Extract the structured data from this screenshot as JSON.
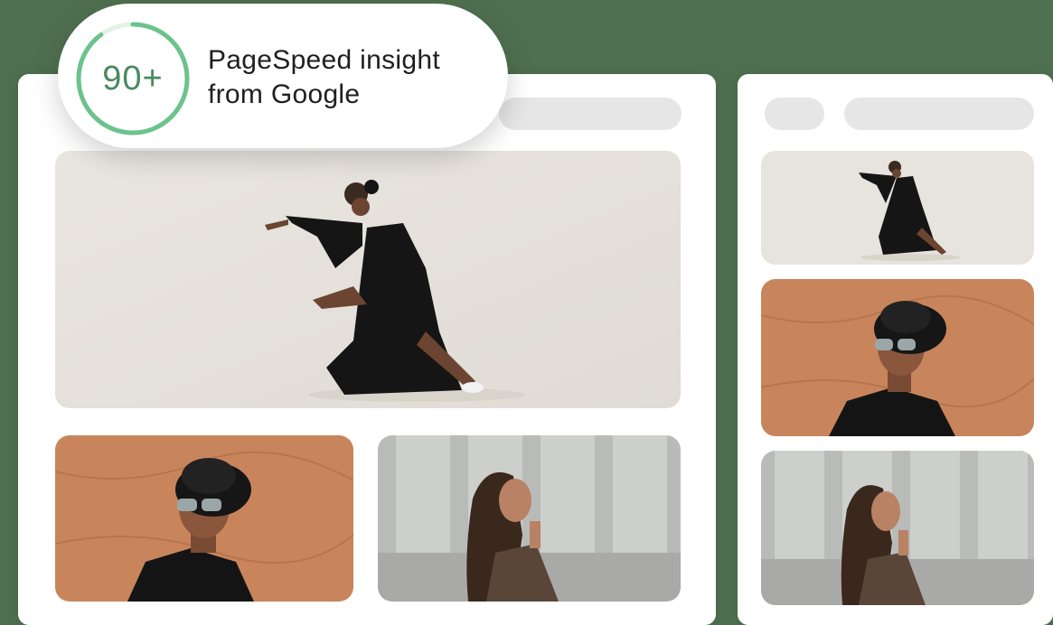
{
  "badge": {
    "score": "90+",
    "score_fraction": 0.9,
    "line1": "PageSpeed insight",
    "line2": "from Google",
    "accent_color": "#6cc38b"
  },
  "desktop_mockup": {
    "images": [
      "dancer-in-black-dress",
      "man-in-black-hat",
      "woman-by-wall"
    ]
  },
  "mobile_mockup": {
    "images": [
      "dancer-in-black-dress",
      "man-in-black-hat",
      "woman-by-wall"
    ]
  }
}
